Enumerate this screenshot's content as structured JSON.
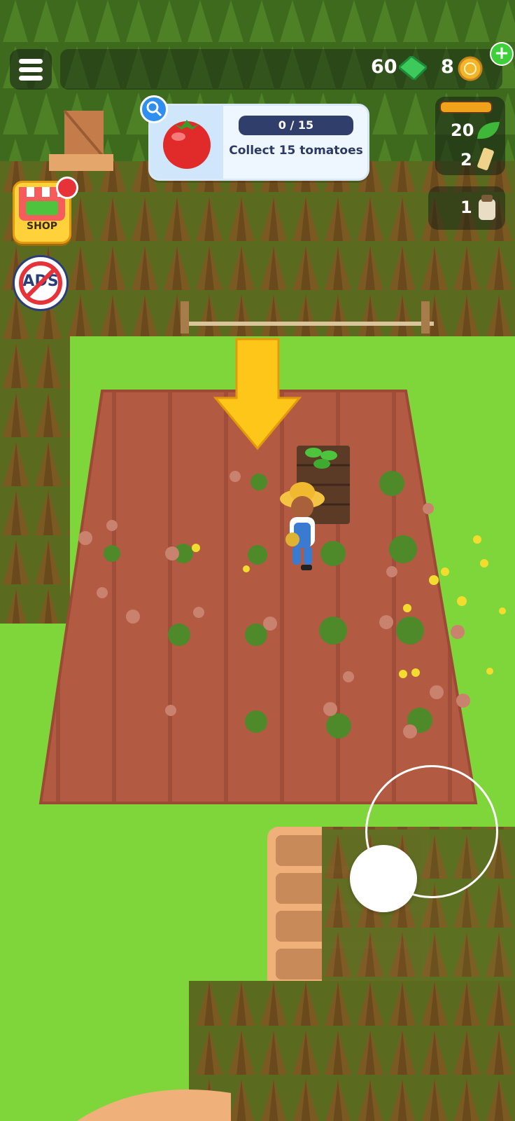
{
  "hud": {
    "cash": "60",
    "coins": "8",
    "plus": "+"
  },
  "quest": {
    "progress": "0 / 15",
    "text": "Collect 15 tomatoes"
  },
  "resources": {
    "leaves": "20",
    "tickets": "2",
    "sacks": "1"
  },
  "buttons": {
    "shop_label": "SHOP",
    "ads_label": "ADS"
  },
  "colors": {
    "grass": "#7fd63a",
    "soil": "#b55a43",
    "trees": "#8a5d2a",
    "accent_yellow": "#ffc61a"
  }
}
